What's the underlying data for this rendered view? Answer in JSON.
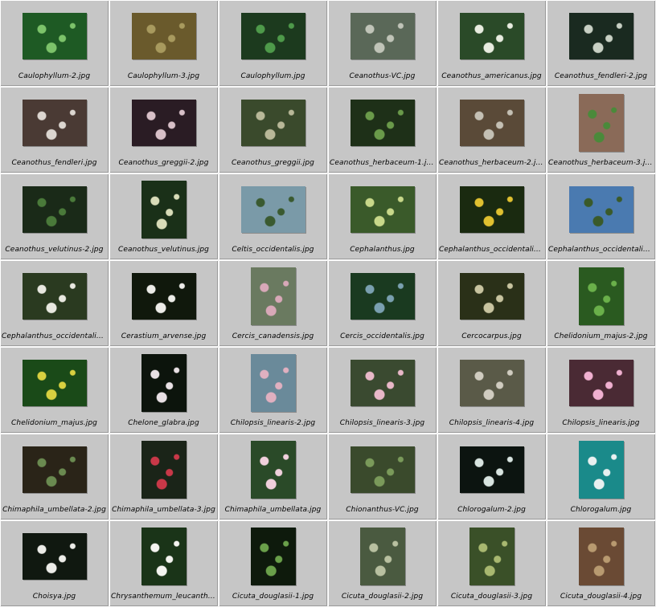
{
  "files": [
    {
      "name": "Caulophyllum-2.jpg",
      "bg": "#1e5a24",
      "fg": "#7cc36a",
      "orient": "landscape"
    },
    {
      "name": "Caulophyllum-3.jpg",
      "bg": "#6a5a2c",
      "fg": "#a89a5e",
      "orient": "landscape"
    },
    {
      "name": "Caulophyllum.jpg",
      "bg": "#1c3a1e",
      "fg": "#4e9a4a",
      "orient": "landscape"
    },
    {
      "name": "Ceanothus-VC.jpg",
      "bg": "#5a6858",
      "fg": "#c0c4b8",
      "orient": "landscape"
    },
    {
      "name": "Ceanothus_americanus.jpg",
      "bg": "#2a4a28",
      "fg": "#e8ece0",
      "orient": "landscape"
    },
    {
      "name": "Ceanothus_fendleri-2.jpg",
      "bg": "#1a2a20",
      "fg": "#c8d0c4",
      "orient": "landscape"
    },
    {
      "name": "Ceanothus_fendleri.jpg",
      "bg": "#4a3a34",
      "fg": "#dcd6d0",
      "orient": "landscape"
    },
    {
      "name": "Ceanothus_greggii-2.jpg",
      "bg": "#2a1c24",
      "fg": "#d8c0c8",
      "orient": "landscape"
    },
    {
      "name": "Ceanothus_greggii.jpg",
      "bg": "#3a4a2c",
      "fg": "#b8b898",
      "orient": "landscape"
    },
    {
      "name": "Ceanothus_herbaceum-1.jpg",
      "bg": "#1e3018",
      "fg": "#6a9a4a",
      "orient": "landscape"
    },
    {
      "name": "Ceanothus_herbaceum-2.jpg",
      "bg": "#5a4a38",
      "fg": "#c4c0b4",
      "orient": "landscape"
    },
    {
      "name": "Ceanothus_herbaceum-3.jpg",
      "bg": "#8a6a58",
      "fg": "#4a8a3a",
      "orient": "portrait"
    },
    {
      "name": "Ceanothus_velutinus-2.jpg",
      "bg": "#1a2a18",
      "fg": "#4a7a3a",
      "orient": "landscape"
    },
    {
      "name": "Ceanothus_velutinus.jpg",
      "bg": "#1a3018",
      "fg": "#d8dcb8",
      "orient": "portrait"
    },
    {
      "name": "Celtis_occidentalis.jpg",
      "bg": "#7a9aa8",
      "fg": "#3a5a30",
      "orient": "landscape"
    },
    {
      "name": "Cephalanthus.jpg",
      "bg": "#3a5a2a",
      "fg": "#c8d88a",
      "orient": "landscape"
    },
    {
      "name": "Cephalanthus_occidentalis-…",
      "bg": "#1a2a10",
      "fg": "#e0c030",
      "orient": "landscape"
    },
    {
      "name": "Cephalanthus_occidentalis-…",
      "bg": "#4a7ab0",
      "fg": "#3a5a2a",
      "orient": "landscape"
    },
    {
      "name": "Cephalanthus_occidentalis-…",
      "bg": "#2a3a20",
      "fg": "#e8e8e0",
      "orient": "landscape"
    },
    {
      "name": "Cerastium_arvense.jpg",
      "bg": "#10180c",
      "fg": "#ecece8",
      "orient": "landscape"
    },
    {
      "name": "Cercis_canadensis.jpg",
      "bg": "#6a7a60",
      "fg": "#d8a8b8",
      "orient": "portrait"
    },
    {
      "name": "Cercis_occidentalis.jpg",
      "bg": "#1a3a20",
      "fg": "#7aa0b0",
      "orient": "landscape"
    },
    {
      "name": "Cercocarpus.jpg",
      "bg": "#2a3018",
      "fg": "#c8c4a0",
      "orient": "landscape"
    },
    {
      "name": "Chelidonium_majus-2.jpg",
      "bg": "#2a5a20",
      "fg": "#6ab04a",
      "orient": "portrait"
    },
    {
      "name": "Chelidonium_majus.jpg",
      "bg": "#1a4a18",
      "fg": "#d8d040",
      "orient": "landscape"
    },
    {
      "name": "Chelone_glabra.jpg",
      "bg": "#0c140c",
      "fg": "#e8e0e4",
      "orient": "portrait"
    },
    {
      "name": "Chilopsis_linearis-2.jpg",
      "bg": "#6a8a9a",
      "fg": "#e0b0c0",
      "orient": "portrait"
    },
    {
      "name": "Chilopsis_linearis-3.jpg",
      "bg": "#3a4a30",
      "fg": "#e8b8c8",
      "orient": "landscape"
    },
    {
      "name": "Chilopsis_linearis-4.jpg",
      "bg": "#5a5a48",
      "fg": "#d0ccc0",
      "orient": "landscape"
    },
    {
      "name": "Chilopsis_linearis.jpg",
      "bg": "#4a2a34",
      "fg": "#f0b0d0",
      "orient": "landscape"
    },
    {
      "name": "Chimaphila_umbellata-2.jpg",
      "bg": "#2a2418",
      "fg": "#6a8a50",
      "orient": "landscape"
    },
    {
      "name": "Chimaphila_umbellata-3.jpg",
      "bg": "#1a2418",
      "fg": "#c83848",
      "orient": "portrait"
    },
    {
      "name": "Chimaphila_umbellata.jpg",
      "bg": "#2a4a28",
      "fg": "#f0d0dc",
      "orient": "portrait"
    },
    {
      "name": "Chionanthus-VC.jpg",
      "bg": "#3a4a2c",
      "fg": "#7a9a5a",
      "orient": "landscape"
    },
    {
      "name": "Chlorogalum-2.jpg",
      "bg": "#0c1410",
      "fg": "#d8e4e0",
      "orient": "landscape"
    },
    {
      "name": "Chlorogalum.jpg",
      "bg": "#1a8a8a",
      "fg": "#e8f0f0",
      "orient": "portrait"
    },
    {
      "name": "Choisya.jpg",
      "bg": "#101810",
      "fg": "#ecece8",
      "orient": "landscape"
    },
    {
      "name": "Chrysanthemum_leucanthe…",
      "bg": "#1a3418",
      "fg": "#f4f4f0",
      "orient": "portrait"
    },
    {
      "name": "Cicuta_douglasii-1.jpg",
      "bg": "#0e1a0c",
      "fg": "#6aa04a",
      "orient": "portrait"
    },
    {
      "name": "Cicuta_douglasii-2.jpg",
      "bg": "#4a5a40",
      "fg": "#b8c0a0",
      "orient": "portrait"
    },
    {
      "name": "Cicuta_douglasii-3.jpg",
      "bg": "#3a5028",
      "fg": "#a8b870",
      "orient": "portrait"
    },
    {
      "name": "Cicuta_douglasii-4.jpg",
      "bg": "#6a4a34",
      "fg": "#b89a70",
      "orient": "portrait"
    }
  ]
}
